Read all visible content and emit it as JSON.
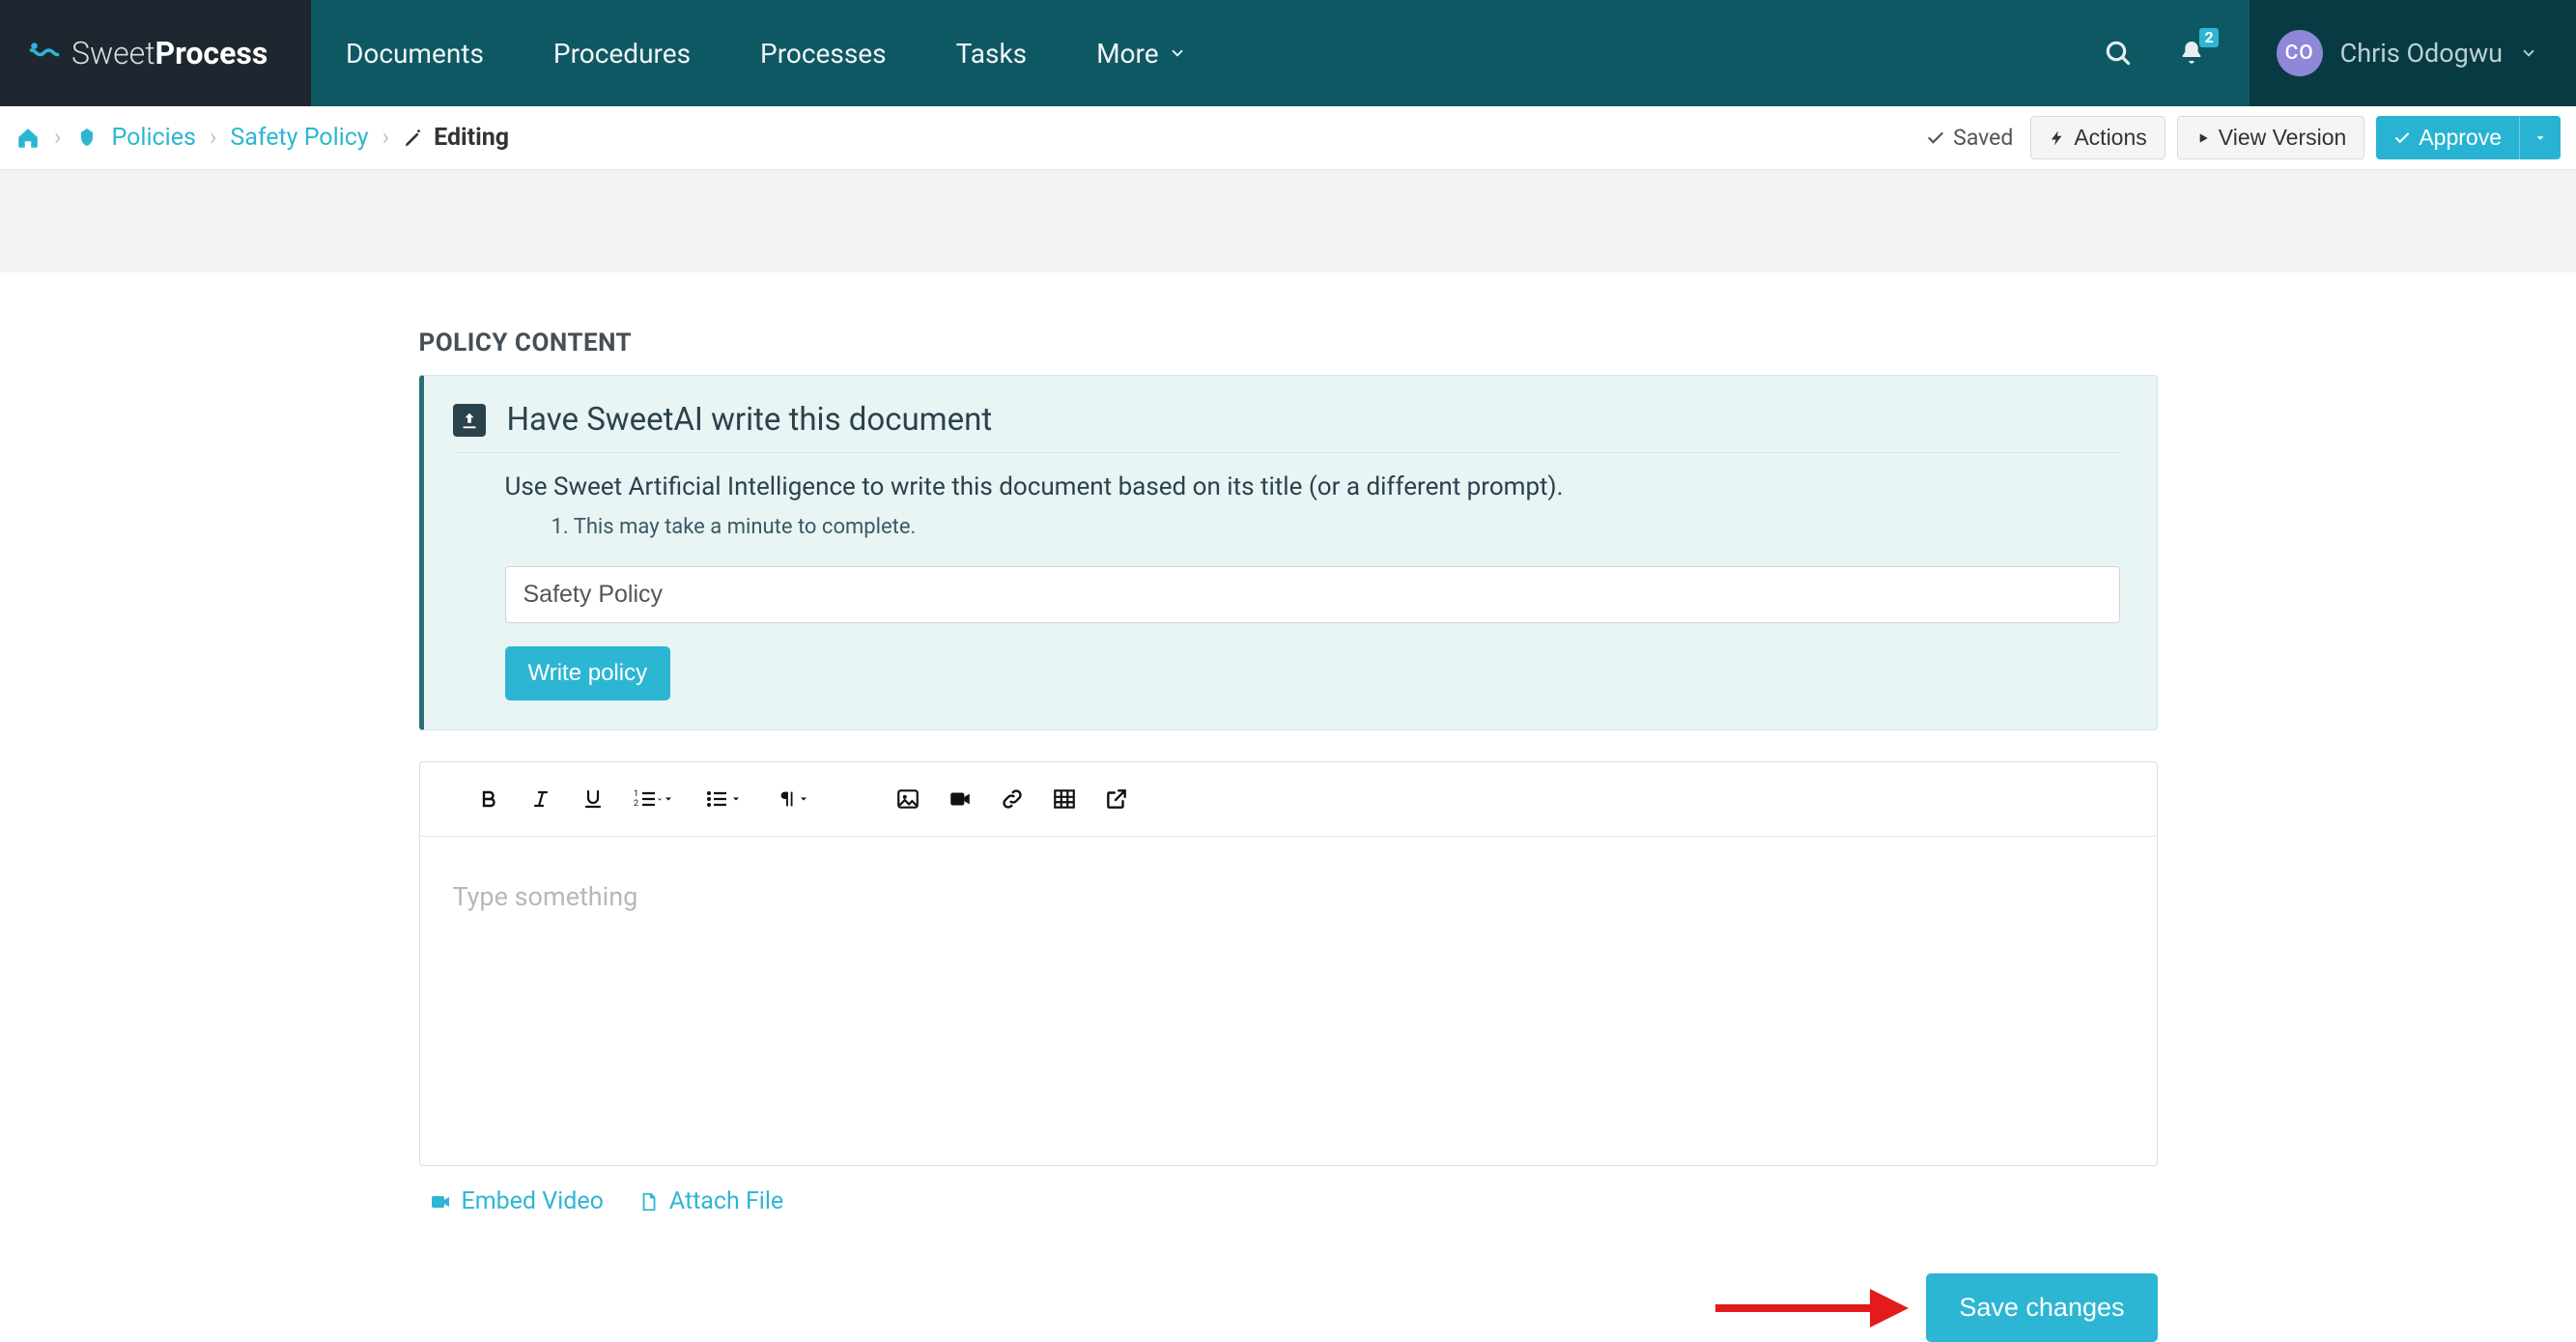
{
  "brand": {
    "name_light": "Sweet",
    "name_bold": "Process"
  },
  "nav": {
    "items": [
      "Documents",
      "Procedures",
      "Processes",
      "Tasks",
      "More"
    ],
    "notifications_count": "2"
  },
  "user": {
    "initials": "CO",
    "name": "Chris Odogwu"
  },
  "breadcrumb": {
    "policies": "Policies",
    "policy": "Safety Policy",
    "editing": "Editing"
  },
  "subbar": {
    "saved": "Saved",
    "actions": "Actions",
    "view_version": "View Version",
    "approve": "Approve"
  },
  "section": {
    "label": "POLICY CONTENT"
  },
  "ai": {
    "title": "Have SweetAI write this document",
    "desc": "Use Sweet Artificial Intelligence to write this document based on its title (or a different prompt).",
    "note": "1. This may take a minute to complete.",
    "input_value": "Safety Policy",
    "button": "Write policy"
  },
  "editor": {
    "placeholder": "Type something",
    "embed_video": "Embed Video",
    "attach_file": "Attach File"
  },
  "save": {
    "label": "Save changes"
  }
}
